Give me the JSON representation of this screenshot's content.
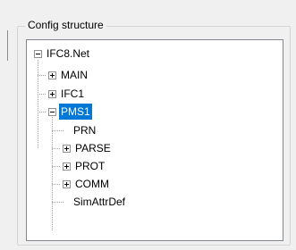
{
  "groupbox": {
    "title": "Config structure"
  },
  "tree": {
    "root": {
      "label": "IFC8.Net",
      "state": "expanded"
    },
    "items": [
      {
        "label": "MAIN",
        "state": "collapsed"
      },
      {
        "label": "IFC1",
        "state": "collapsed"
      },
      {
        "label": "PMS1",
        "state": "expanded",
        "selected": true
      },
      {
        "label": "PRN",
        "state": "leaf"
      },
      {
        "label": "PARSE",
        "state": "collapsed"
      },
      {
        "label": "PROT",
        "state": "collapsed"
      },
      {
        "label": "COMM",
        "state": "collapsed"
      },
      {
        "label": "SimAttrDef",
        "state": "leaf"
      }
    ]
  },
  "colors": {
    "selection": "#0078d7",
    "background": "#f0f0f0",
    "tree_background": "#ffffff"
  }
}
